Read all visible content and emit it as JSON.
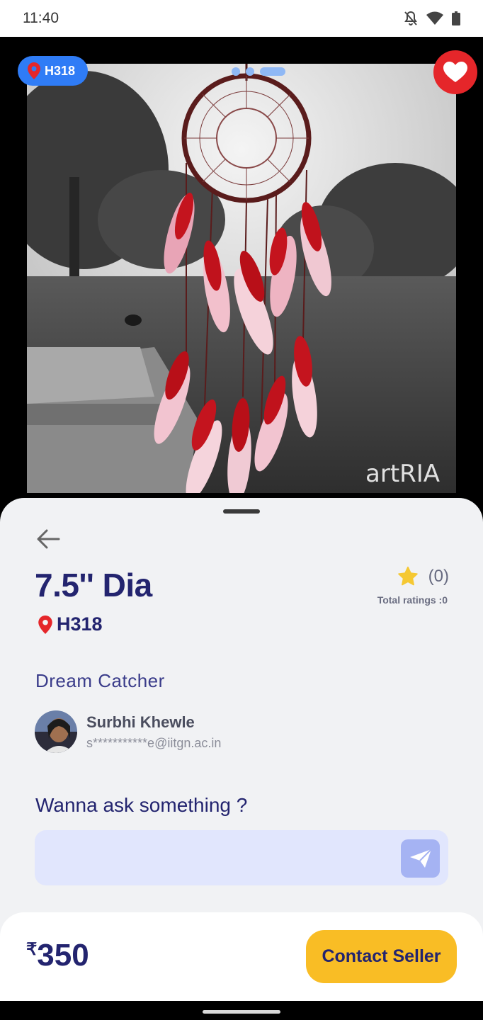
{
  "status_bar": {
    "time": "11:40",
    "icons": [
      "bell-off-icon",
      "wifi-icon",
      "battery-icon"
    ]
  },
  "media": {
    "location_chip": "H318",
    "watermark": "artRIA",
    "carousel_dots": 3,
    "favorite_icon": "heart-icon",
    "favorite_color": "#e5262a"
  },
  "product": {
    "title": "7.5'' Dia",
    "location": "H318",
    "rating_count": "(0)",
    "total_ratings": "Total ratings :0",
    "category": "Dream Catcher"
  },
  "seller": {
    "name": "Surbhi Khewle",
    "email": "s***********e@iitgn.ac.in"
  },
  "ask": {
    "title": "Wanna ask something ?",
    "placeholder": ""
  },
  "footer": {
    "currency": "₹",
    "price": "350",
    "contact_label": "Contact Seller",
    "accent": "#f9bd25"
  },
  "colors": {
    "primary_text": "#23246f",
    "chip_blue": "#2f7cf6",
    "sheet_bg": "#f1f2f4"
  }
}
